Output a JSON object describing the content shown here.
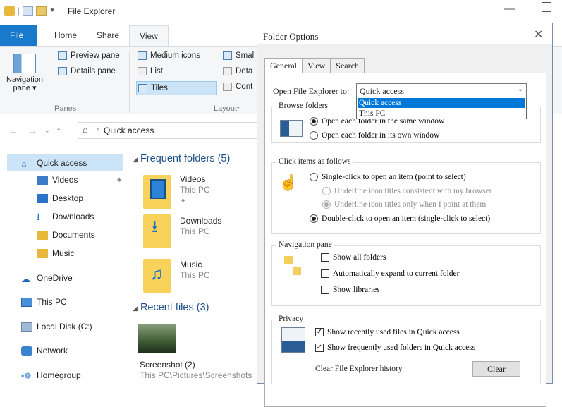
{
  "window": {
    "title": "File Explorer"
  },
  "ribbon": {
    "tabs": [
      "File",
      "Home",
      "Share",
      "View"
    ],
    "nav_pane": "Navigation pane ▾",
    "preview_pane": "Preview pane",
    "details_pane": "Details pane",
    "medium_icons": "Medium icons",
    "small": "Smal",
    "list": "List",
    "details": "Deta",
    "tiles": "Tiles",
    "content": "Cont",
    "group_panes": "Panes",
    "group_layout": "Layout"
  },
  "address": {
    "crumb": "Quick access"
  },
  "nav": {
    "items": [
      {
        "label": "Quick access"
      },
      {
        "label": "Videos"
      },
      {
        "label": "Desktop"
      },
      {
        "label": "Downloads"
      },
      {
        "label": "Documents"
      },
      {
        "label": "Music"
      },
      {
        "label": "OneDrive"
      },
      {
        "label": "This PC"
      },
      {
        "label": "Local Disk (C:)"
      },
      {
        "label": "Network"
      },
      {
        "label": "Homegroup"
      }
    ]
  },
  "content": {
    "frequent_header": "Frequent folders (5)",
    "folders": [
      {
        "name": "Videos",
        "location": "This PC"
      },
      {
        "name": "Downloads",
        "location": "This PC"
      },
      {
        "name": "Music",
        "location": "This PC"
      }
    ],
    "recent_header": "Recent files (3)",
    "recent": [
      {
        "name": "Screenshot (2)",
        "location": "This PC\\Pictures\\Screenshots"
      }
    ]
  },
  "dialog": {
    "title": "Folder Options",
    "tabs": [
      "General",
      "View",
      "Search"
    ],
    "open_label": "Open File Explorer to:",
    "open_value": "Quick access",
    "open_options": [
      "Quick access",
      "This PC"
    ],
    "browse": {
      "title": "Browse folders",
      "opt_same": "Open each folder in the same window",
      "opt_own": "Open each folder in its own window"
    },
    "click": {
      "title": "Click items as follows",
      "single": "Single-click to open an item (point to select)",
      "underline_browser": "Underline icon titles consistent with my browser",
      "underline_point": "Underline icon titles only when I point at them",
      "double": "Double-click to open an item (single-click to select)"
    },
    "navpane": {
      "title": "Navigation pane",
      "show_all": "Show all folders",
      "expand": "Automatically expand to current folder",
      "libraries": "Show libraries"
    },
    "privacy": {
      "title": "Privacy",
      "recent_files": "Show recently used files in Quick access",
      "frequent_folders": "Show frequently used folders in Quick access",
      "clear_label": "Clear File Explorer history",
      "clear_button": "Clear"
    }
  }
}
